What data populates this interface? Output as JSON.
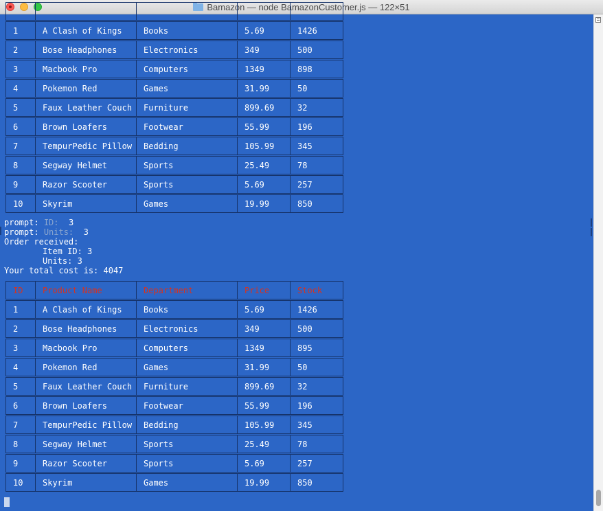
{
  "window": {
    "title": "Bamazon — node BamazonCustomer.js — 122×51"
  },
  "table_headers": [
    "ID",
    "Product Name",
    "Department",
    "Price",
    "Stock"
  ],
  "table_before": [
    [
      "1",
      "A Clash of Kings",
      "Books",
      "5.69",
      "1426"
    ],
    [
      "2",
      "Bose Headphones",
      "Electronics",
      "349",
      "500"
    ],
    [
      "3",
      "Macbook Pro",
      "Computers",
      "1349",
      "898"
    ],
    [
      "4",
      "Pokemon Red",
      "Games",
      "31.99",
      "50"
    ],
    [
      "5",
      "Faux Leather Couch",
      "Furniture",
      "899.69",
      "32"
    ],
    [
      "6",
      "Brown Loafers",
      "Footwear",
      "55.99",
      "196"
    ],
    [
      "7",
      "TempurPedic Pillow",
      "Bedding",
      "105.99",
      "345"
    ],
    [
      "8",
      "Segway Helmet",
      "Sports",
      "25.49",
      "78"
    ],
    [
      "9",
      "Razor Scooter",
      "Sports",
      "5.69",
      "257"
    ],
    [
      "10",
      "Skyrim",
      "Games",
      "19.99",
      "850"
    ]
  ],
  "console": {
    "prompt_label": "prompt:",
    "id_label": "ID:",
    "id_value": "3",
    "units_label": "Units:",
    "units_value": "3",
    "order_received": "Order received:",
    "item_id_line": "Item ID: 3",
    "units_line": "Units: 3",
    "total_line": "Your total cost is: 4047"
  },
  "table_after": [
    [
      "1",
      "A Clash of Kings",
      "Books",
      "5.69",
      "1426"
    ],
    [
      "2",
      "Bose Headphones",
      "Electronics",
      "349",
      "500"
    ],
    [
      "3",
      "Macbook Pro",
      "Computers",
      "1349",
      "895"
    ],
    [
      "4",
      "Pokemon Red",
      "Games",
      "31.99",
      "50"
    ],
    [
      "5",
      "Faux Leather Couch",
      "Furniture",
      "899.69",
      "32"
    ],
    [
      "6",
      "Brown Loafers",
      "Footwear",
      "55.99",
      "196"
    ],
    [
      "7",
      "TempurPedic Pillow",
      "Bedding",
      "105.99",
      "345"
    ],
    [
      "8",
      "Segway Helmet",
      "Sports",
      "25.49",
      "78"
    ],
    [
      "9",
      "Razor Scooter",
      "Sports",
      "5.69",
      "257"
    ],
    [
      "10",
      "Skyrim",
      "Games",
      "19.99",
      "850"
    ]
  ],
  "colors": {
    "background": "#2c66c6",
    "header_text": "#d8321f",
    "border": "#16336a"
  }
}
